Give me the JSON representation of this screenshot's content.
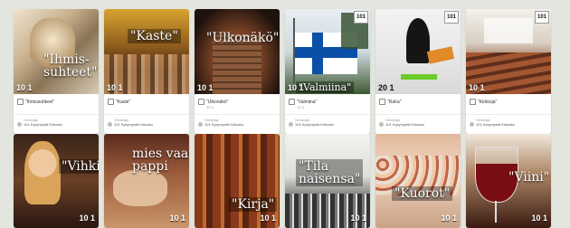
{
  "cards": [
    {
      "caption": "\"Ihmis-\nsuhteet\"",
      "badge": "10 1",
      "title": "\"Ihmissuhteet\"",
      "sub": "",
      "owner_label": "Omistaja",
      "owner": "101 Kysymystä Kirkosta"
    },
    {
      "caption": "\"Kaste\"",
      "badge": "10 1",
      "title": "\"Kaste\"",
      "sub": "",
      "owner_label": "Omistaja",
      "owner": "101 Kysymystä Kirkosta"
    },
    {
      "caption": "\"Ulkonäkö\"",
      "badge": "10 1",
      "title": "\"Ulkonäkö\"",
      "sub": "10 3",
      "owner_label": "Omistaja",
      "owner": "101 Kysymystä Kirkosta"
    },
    {
      "caption": "\"Valmiina\"",
      "badge": "10 1",
      "title": "\"Valmiina\"",
      "sub": "10 3",
      "owner_label": "Omistaja",
      "owner": "101 Kysymystä Kirkosta"
    },
    {
      "caption": "",
      "badge": "20 1",
      "title": "\"Raha\"",
      "sub": "",
      "owner_label": "Omistaja",
      "owner": "101 Kysymystä Kirkosta"
    },
    {
      "caption": "",
      "badge": "10 1",
      "title": "\"Kirkkoja\"",
      "sub": "",
      "owner_label": "Omistaja",
      "owner": "101 Kysymystä Kirkosta"
    },
    {
      "caption": "\"Vihki\"",
      "badge": "10 1",
      "title": "",
      "sub": "",
      "owner_label": "",
      "owner": ""
    },
    {
      "caption": "mies vaan\npappi",
      "badge": "10 1",
      "title": "",
      "sub": "",
      "owner_label": "",
      "owner": ""
    },
    {
      "caption": "\"Kirja\"",
      "badge": "10 1",
      "title": "",
      "sub": "",
      "owner_label": "",
      "owner": ""
    },
    {
      "caption": "\"Tila\nnaisensa\"",
      "badge": "10 1",
      "title": "",
      "sub": "",
      "owner_label": "",
      "owner": ""
    },
    {
      "caption": "\"Kuorot\"",
      "badge": "10 1",
      "title": "",
      "sub": "",
      "owner_label": "",
      "owner": ""
    },
    {
      "caption": "\"Viini\"",
      "badge": "10 1",
      "title": "",
      "sub": "",
      "owner_label": "",
      "owner": ""
    }
  ],
  "logo_text": "101",
  "colors": {
    "background": "#e3e5df",
    "card": "#ffffff"
  }
}
